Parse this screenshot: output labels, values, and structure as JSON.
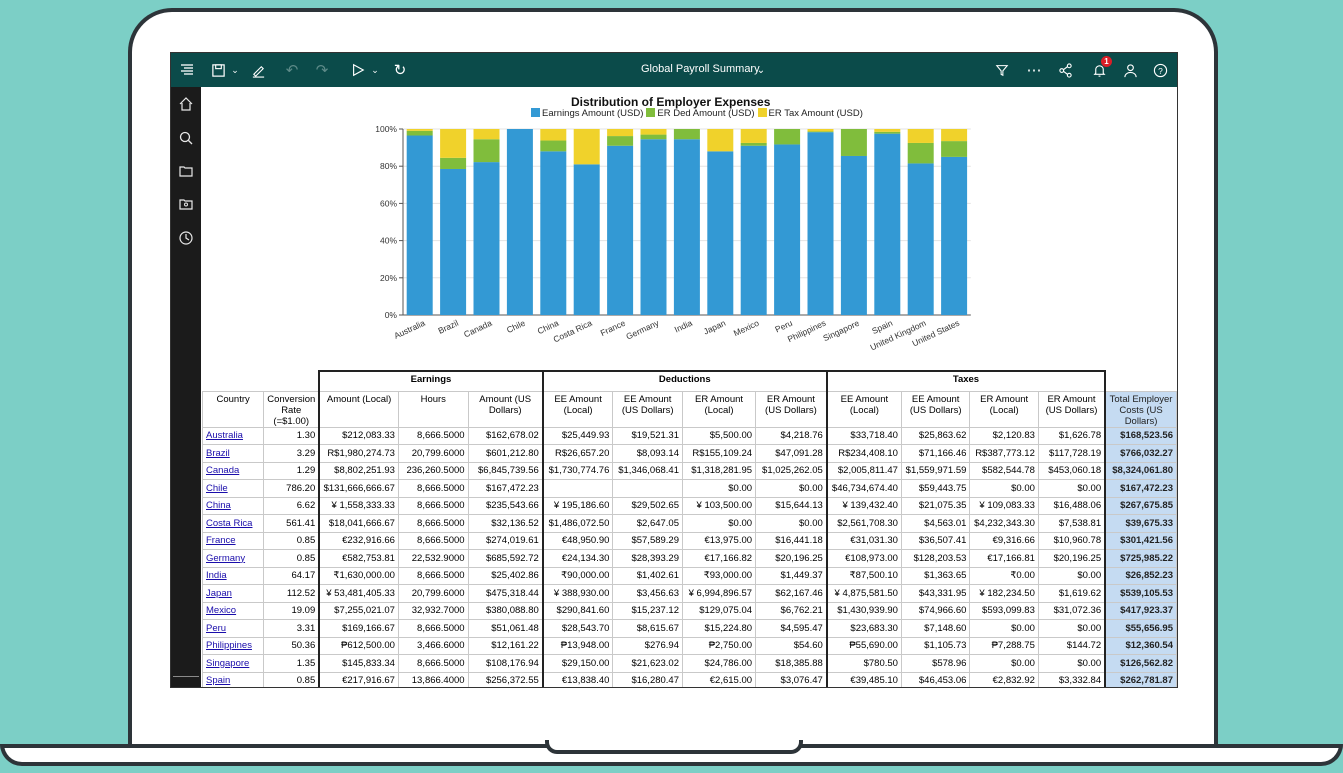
{
  "app": {
    "title": "Global Payroll Summary",
    "notification_count": "1"
  },
  "icons": {
    "toolbar": [
      "hamburger-icon",
      "save-icon",
      "chevron-down-icon",
      "edit-icon",
      "undo-icon",
      "redo-icon",
      "run-icon",
      "chevron-down-icon",
      "refresh-icon",
      "filter-icon",
      "more-icon",
      "share-icon",
      "bell-icon",
      "user-icon",
      "help-icon"
    ],
    "sidebar": [
      "home-icon",
      "search-icon",
      "folder-icon",
      "team-folder-icon",
      "recent-icon"
    ]
  },
  "colors": {
    "topbar": "#0b4b4a",
    "earnings": "#3399d4",
    "er_ded": "#80bd3c",
    "er_tax": "#f0d22b",
    "total_col": "#c5dbf2"
  },
  "chart_data": {
    "type": "bar",
    "stacked": true,
    "title": "Distribution of Employer Expenses",
    "categories": [
      "Australia",
      "Brazil",
      "Canada",
      "Chile",
      "China",
      "Costa Rica",
      "France",
      "Germany",
      "India",
      "Japan",
      "Mexico",
      "Peru",
      "Philippines",
      "Singapore",
      "Spain",
      "United Kingdom",
      "United States"
    ],
    "series": [
      {
        "name": "Earnings Amount (USD)",
        "color": "#3399d4",
        "values": [
          96.5,
          78.5,
          82.2,
          100,
          88,
          81,
          91,
          94.5,
          94.5,
          88,
          91,
          91.7,
          98.3,
          85.5,
          97.5,
          81.5,
          85
        ]
      },
      {
        "name": "ER Ded Amount (USD)",
        "color": "#80bd3c",
        "values": [
          2.5,
          6,
          12.3,
          0,
          5.8,
          0,
          5.2,
          2.5,
          5.5,
          0,
          1.5,
          8.3,
          0.4,
          14.5,
          1,
          11,
          8.5
        ]
      },
      {
        "name": "ER Tax Amount (USD)",
        "color": "#f0d22b",
        "values": [
          1,
          15.5,
          5.5,
          0,
          6.2,
          19,
          3.8,
          3,
          0,
          12,
          7.5,
          0,
          1.3,
          0,
          1.5,
          7.5,
          6.5
        ]
      }
    ],
    "yticks": [
      "0%",
      "20%",
      "40%",
      "60%",
      "80%",
      "100%"
    ],
    "ylim": [
      0,
      100
    ],
    "legend": "top"
  },
  "table": {
    "group_headers": {
      "earnings": "Earnings",
      "deductions": "Deductions",
      "taxes": "Taxes"
    },
    "columns": [
      "Country",
      "Conversion Rate (=$1.00)",
      "Amount (Local)",
      "Hours",
      "Amount (US Dollars)",
      "EE Amount (Local)",
      "EE Amount (US Dollars)",
      "ER Amount (Local)",
      "ER Amount (US Dollars)",
      "EE Amount (Local)",
      "EE Amount (US Dollars)",
      "ER Amount (Local)",
      "ER Amount (US Dollars)",
      "Total Employer Costs (US Dollars)"
    ],
    "rows": [
      [
        "Australia",
        "1.30",
        "$212,083.33",
        "8,666.5000",
        "$162,678.02",
        "$25,449.93",
        "$19,521.31",
        "$5,500.00",
        "$4,218.76",
        "$33,718.40",
        "$25,863.62",
        "$2,120.83",
        "$1,626.78",
        "$168,523.56"
      ],
      [
        "Brazil",
        "3.29",
        "R$1,980,274.73",
        "20,799.6000",
        "$601,212.80",
        "R$26,657.20",
        "$8,093.14",
        "R$155,109.24",
        "$47,091.28",
        "R$234,408.10",
        "$71,166.46",
        "R$387,773.12",
        "$117,728.19",
        "$766,032.27"
      ],
      [
        "Canada",
        "1.29",
        "$8,802,251.93",
        "236,260.5000",
        "$6,845,739.56",
        "$1,730,774.76",
        "$1,346,068.41",
        "$1,318,281.95",
        "$1,025,262.05",
        "$2,005,811.47",
        "$1,559,971.59",
        "$582,544.78",
        "$453,060.18",
        "$8,324,061.80"
      ],
      [
        "Chile",
        "786.20",
        "$131,666,666.67",
        "8,666.5000",
        "$167,472.23",
        "",
        "",
        "$0.00",
        "$0.00",
        "$46,734,674.40",
        "$59,443.75",
        "$0.00",
        "$0.00",
        "$167,472.23"
      ],
      [
        "China",
        "6.62",
        "¥ 1,558,333.33",
        "8,666.5000",
        "$235,543.66",
        "¥ 195,186.60",
        "$29,502.65",
        "¥ 103,500.00",
        "$15,644.13",
        "¥ 139,432.40",
        "$21,075.35",
        "¥ 109,083.33",
        "$16,488.06",
        "$267,675.85"
      ],
      [
        "Costa Rica",
        "561.41",
        "$18,041,666.67",
        "8,666.5000",
        "$32,136.52",
        "$1,486,072.50",
        "$2,647.05",
        "$0.00",
        "$0.00",
        "$2,561,708.30",
        "$4,563.01",
        "$4,232,343.30",
        "$7,538.81",
        "$39,675.33"
      ],
      [
        "France",
        "0.85",
        "€232,916.66",
        "8,666.5000",
        "$274,019.61",
        "€48,950.90",
        "$57,589.29",
        "€13,975.00",
        "$16,441.18",
        "€31,031.30",
        "$36,507.41",
        "€9,316.66",
        "$10,960.78",
        "$301,421.56"
      ],
      [
        "Germany",
        "0.85",
        "€582,753.81",
        "22,532.9000",
        "$685,592.72",
        "€24,134.30",
        "$28,393.29",
        "€17,166.82",
        "$20,196.25",
        "€108,973.00",
        "$128,203.53",
        "€17,166.81",
        "$20,196.25",
        "$725,985.22"
      ],
      [
        "India",
        "64.17",
        "₹1,630,000.00",
        "8,666.5000",
        "$25,402.86",
        "₹90,000.00",
        "$1,402.61",
        "₹93,000.00",
        "$1,449.37",
        "₹87,500.10",
        "$1,363.65",
        "₹0.00",
        "$0.00",
        "$26,852.23"
      ],
      [
        "Japan",
        "112.52",
        "¥ 53,481,405.33",
        "20,799.6000",
        "$475,318.44",
        "¥ 388,930.00",
        "$3,456.63",
        "¥ 6,994,896.57",
        "$62,167.46",
        "¥ 4,875,581.50",
        "$43,331.95",
        "¥ 182,234.50",
        "$1,619.62",
        "$539,105.53"
      ],
      [
        "Mexico",
        "19.09",
        "$7,255,021.07",
        "32,932.7000",
        "$380,088.80",
        "$290,841.60",
        "$15,237.12",
        "$129,075.04",
        "$6,762.21",
        "$1,430,939.90",
        "$74,966.60",
        "$593,099.83",
        "$31,072.36",
        "$417,923.37"
      ],
      [
        "Peru",
        "3.31",
        "$169,166.67",
        "8,666.5000",
        "$51,061.48",
        "$28,543.70",
        "$8,615.67",
        "$15,224.80",
        "$4,595.47",
        "$23,683.30",
        "$7,148.60",
        "$0.00",
        "$0.00",
        "$55,656.95"
      ],
      [
        "Philippines",
        "50.36",
        "₱612,500.00",
        "3,466.6000",
        "$12,161.22",
        "₱13,948.00",
        "$276.94",
        "₱2,750.00",
        "$54.60",
        "₱55,690.00",
        "$1,105.73",
        "₱7,288.75",
        "$144.72",
        "$12,360.54"
      ],
      [
        "Singapore",
        "1.35",
        "$145,833.34",
        "8,666.5000",
        "$108,176.94",
        "$29,150.00",
        "$21,623.02",
        "$24,786.00",
        "$18,385.88",
        "$780.50",
        "$578.96",
        "$0.00",
        "$0.00",
        "$126,562.82"
      ],
      [
        "Spain",
        "0.85",
        "€217,916.67",
        "13,866.4000",
        "$256,372.55",
        "€13,838.40",
        "$16,280.47",
        "€2,615.00",
        "$3,076.47",
        "€39,485.10",
        "$46,453.06",
        "€2,832.92",
        "$3,332.84",
        "$262,781.87"
      ]
    ]
  }
}
